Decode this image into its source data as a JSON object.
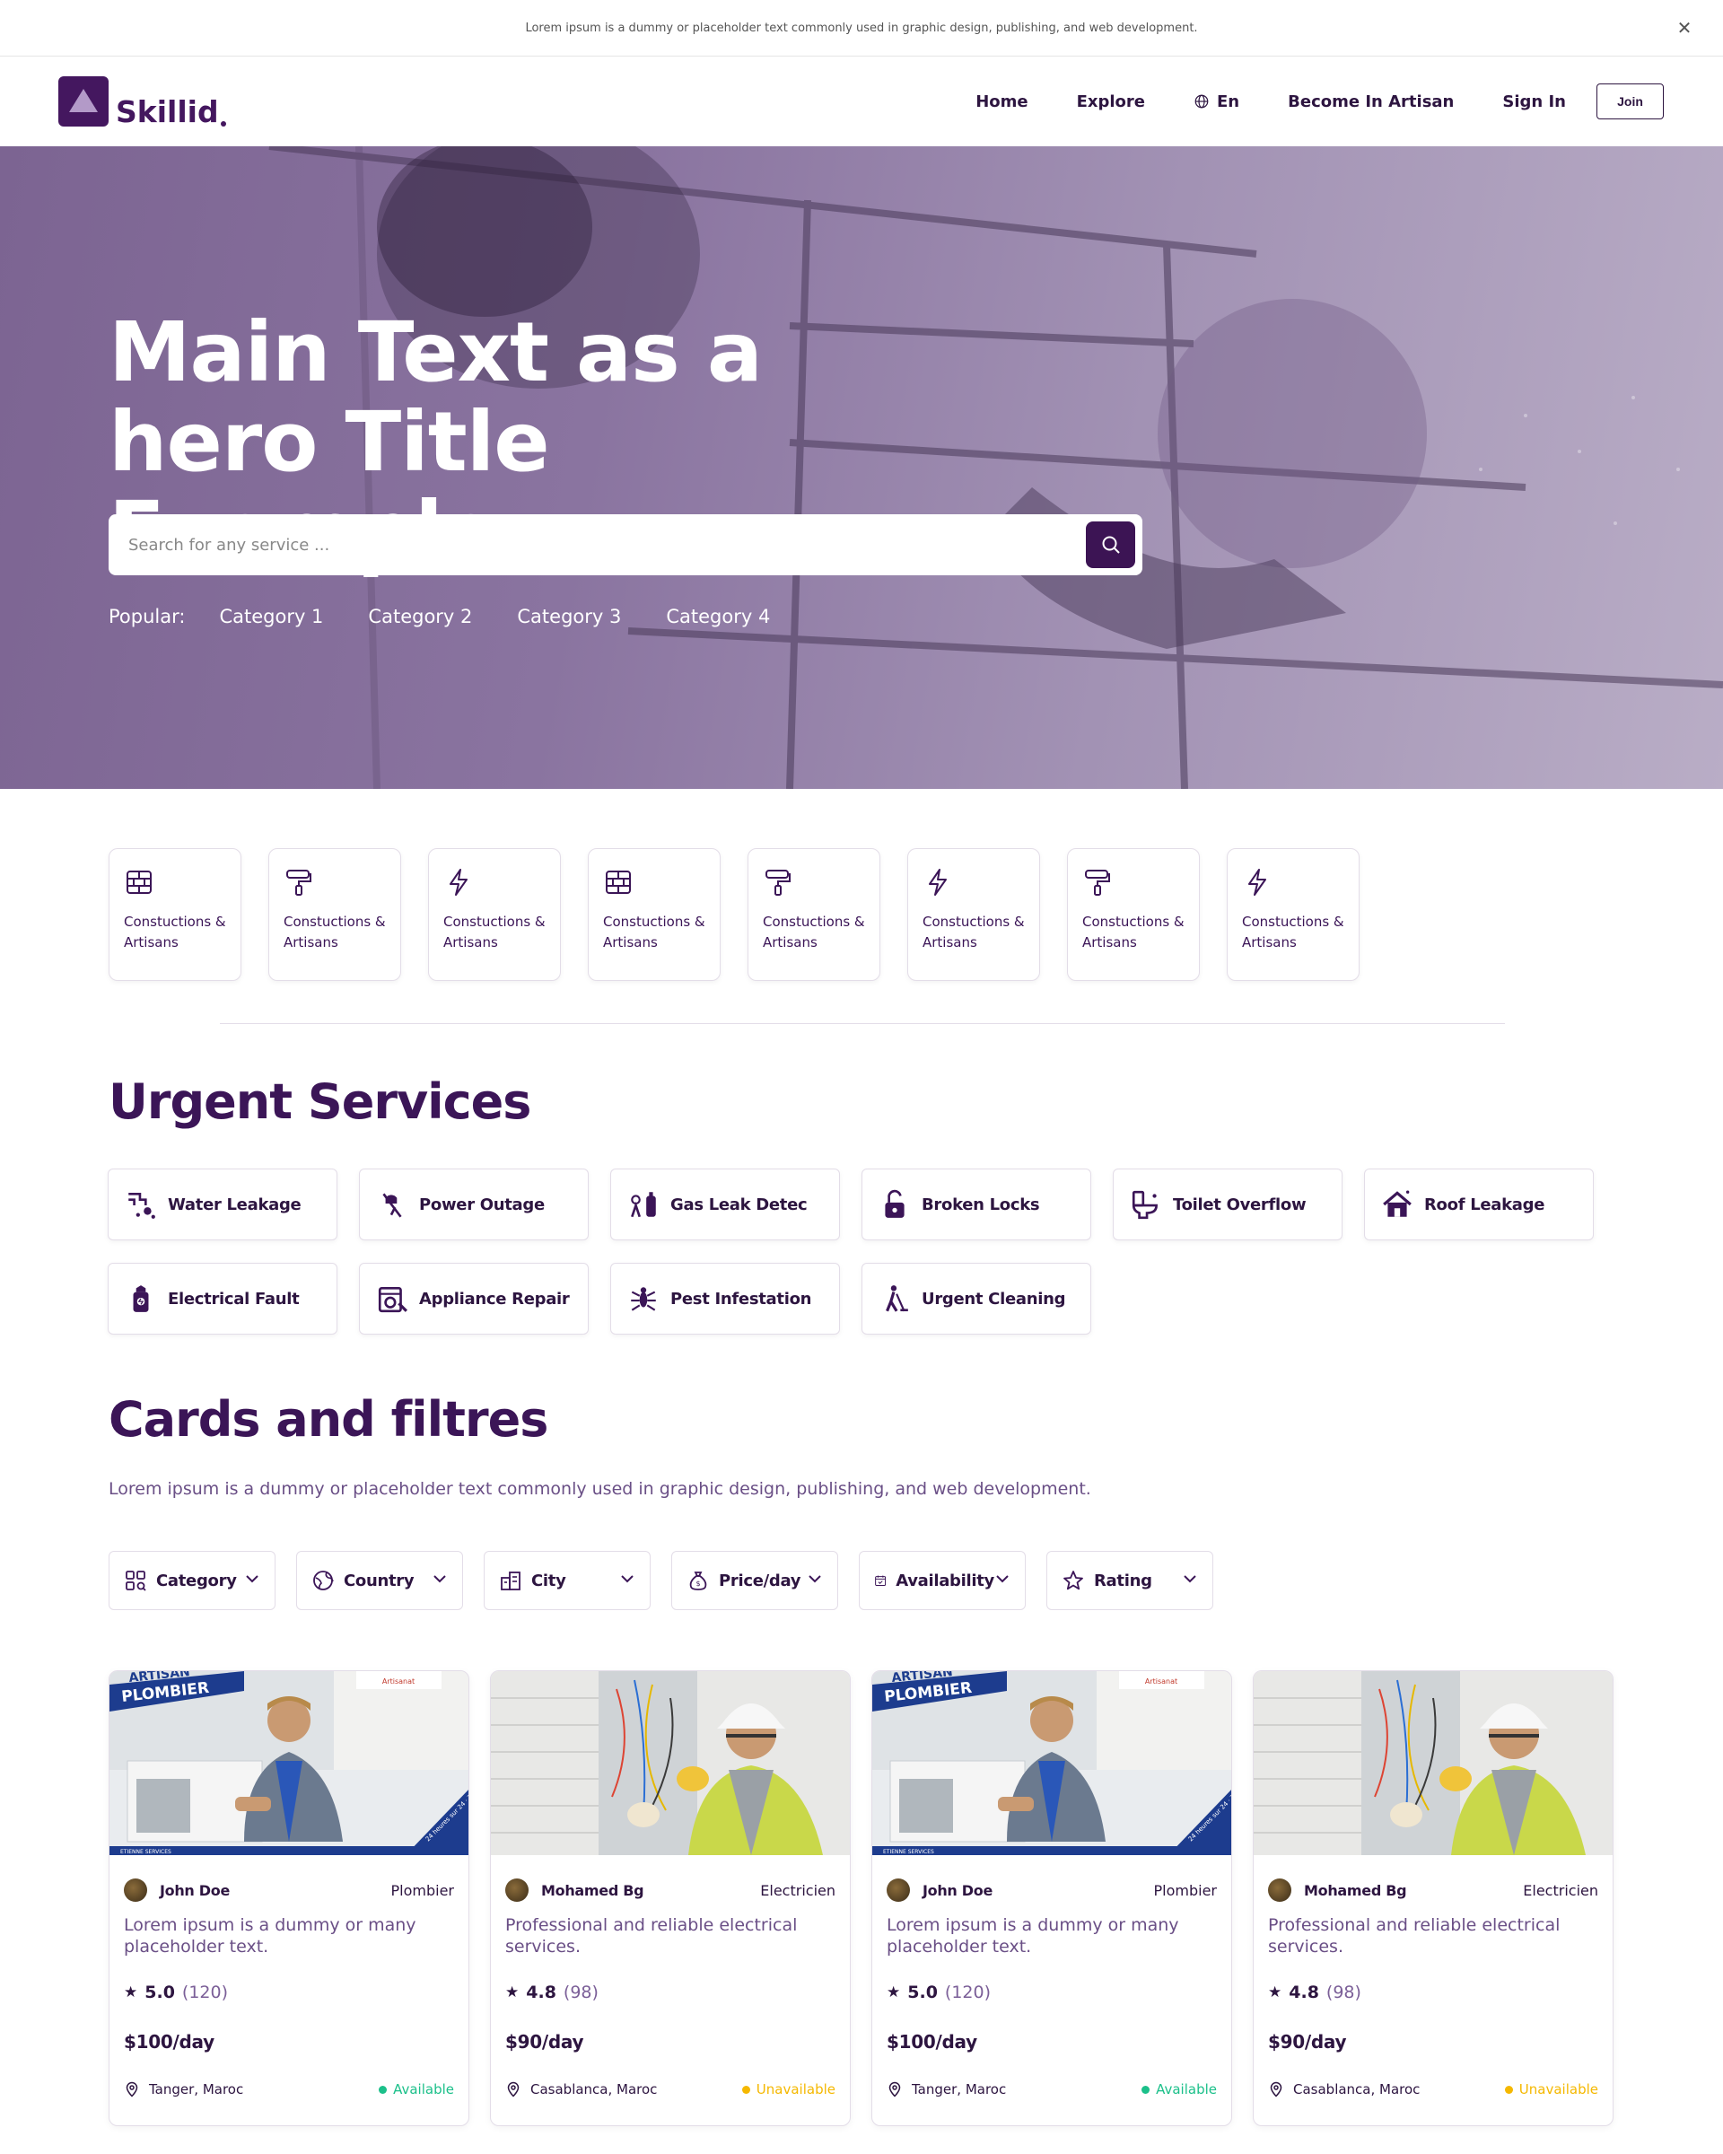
{
  "announcement": {
    "text": "Lorem ipsum is a dummy or placeholder text commonly used in graphic design, publishing, and web development.",
    "close_icon": "close-icon"
  },
  "header": {
    "logo_text": "Skillid",
    "nav": {
      "home": "Home",
      "explore": "Explore",
      "language": "En",
      "become": "Become In Artisan",
      "signin": "Sign In",
      "join": "Join"
    }
  },
  "hero": {
    "title_line1": "Main Text as a",
    "title_line2": "hero Title Exemple",
    "search_placeholder": "Search for any service ...",
    "popular_label": "Popular:",
    "popular": [
      "Category 1",
      "Category 2",
      "Category 3",
      "Category 4"
    ]
  },
  "categories": [
    {
      "icon": "bricks-icon",
      "line1": "Constuctions &",
      "line2": "Artisans"
    },
    {
      "icon": "paint-roller-icon",
      "line1": "Constuctions &",
      "line2": "Artisans"
    },
    {
      "icon": "lightning-icon",
      "line1": "Constuctions &",
      "line2": "Artisans"
    },
    {
      "icon": "bricks-icon",
      "line1": "Constuctions &",
      "line2": "Artisans"
    },
    {
      "icon": "paint-roller-icon",
      "line1": "Constuctions &",
      "line2": "Artisans"
    },
    {
      "icon": "lightning-icon",
      "line1": "Constuctions &",
      "line2": "Artisans"
    },
    {
      "icon": "paint-roller-icon",
      "line1": "Constuctions &",
      "line2": "Artisans"
    },
    {
      "icon": "lightning-icon",
      "line1": "Constuctions &",
      "line2": "Artisans"
    }
  ],
  "urgent": {
    "title": "Urgent Services",
    "items": [
      {
        "icon": "pipe-leak-icon",
        "label": "Water Leakage"
      },
      {
        "icon": "power-outage-icon",
        "label": "Power Outage"
      },
      {
        "icon": "gas-leak-icon",
        "label": "Gas Leak Detec"
      },
      {
        "icon": "broken-lock-icon",
        "label": "Broken Locks"
      },
      {
        "icon": "toilet-icon",
        "label": "Toilet Overflow"
      },
      {
        "icon": "roof-leak-icon",
        "label": "Roof Leakage"
      },
      {
        "icon": "electrical-fault-icon",
        "label": "Electrical Fault"
      },
      {
        "icon": "appliance-repair-icon",
        "label": "Appliance Repair"
      },
      {
        "icon": "pest-icon",
        "label": "Pest Infestation"
      },
      {
        "icon": "cleaning-icon",
        "label": "Urgent Cleaning"
      }
    ]
  },
  "cards_section": {
    "title": "Cards and filtres",
    "lead": "Lorem ipsum is a dummy or placeholder text commonly used in graphic design, publishing, and web development.",
    "filters": [
      {
        "icon": "category-icon",
        "label": "Category"
      },
      {
        "icon": "globe-icon",
        "label": "Country"
      },
      {
        "icon": "city-icon",
        "label": "City"
      },
      {
        "icon": "money-bag-icon",
        "label": "Price/day"
      },
      {
        "icon": "calendar-icon",
        "label": "Availability"
      },
      {
        "icon": "star-icon",
        "label": "Rating"
      }
    ],
    "cards": [
      {
        "image": "plumber",
        "name": "John Doe",
        "role": "Plombier",
        "desc": "Lorem ipsum is a dummy or many placeholder text.",
        "rating": "5.0",
        "count": "(120)",
        "price": "$100/day",
        "city": "Tanger, Maroc",
        "status": "Available",
        "status_color": "#1cc08a"
      },
      {
        "image": "electrician",
        "name": "Mohamed Bg",
        "role": "Electricien",
        "desc": "Professional and reliable electrical services.",
        "rating": "4.8",
        "count": "(98)",
        "price": "$90/day",
        "city": "Casablanca, Maroc",
        "status": "Unavailable",
        "status_color": "#f5b800"
      },
      {
        "image": "plumber",
        "name": "John Doe",
        "role": "Plombier",
        "desc": "Lorem ipsum is a dummy or many placeholder text.",
        "rating": "5.0",
        "count": "(120)",
        "price": "$100/day",
        "city": "Tanger, Maroc",
        "status": "Available",
        "status_color": "#1cc08a"
      },
      {
        "image": "electrician",
        "name": "Mohamed Bg",
        "role": "Electricien",
        "desc": "Professional and reliable electrical services.",
        "rating": "4.8",
        "count": "(98)",
        "price": "$90/day",
        "city": "Casablanca, Maroc",
        "status": "Unavailable",
        "status_color": "#f5b800"
      }
    ],
    "plumber_banner": {
      "line1": "ARTISAN",
      "line2": "PLOMBIER",
      "corner": "24 heures sur 24 · 7 jours sur 7",
      "footer": "ETIENNE SERVICES",
      "brand": "Artisanat"
    }
  },
  "colors": {
    "brand": "#44175f",
    "text": "#3b1557",
    "muted": "#6a4f86",
    "available": "#1cc08a",
    "unavailable": "#f5b800"
  }
}
